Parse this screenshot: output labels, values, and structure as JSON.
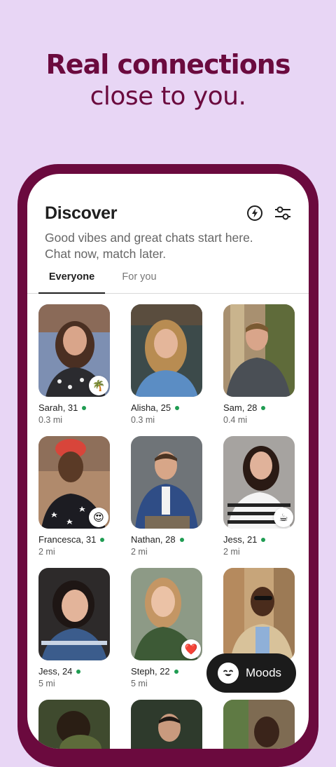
{
  "headline": {
    "line1": "Real connections",
    "line2": "close to you."
  },
  "discover": {
    "title": "Discover",
    "subtitle_line1": "Good vibes and great chats start here.",
    "subtitle_line2": "Chat now, match later.",
    "icons": [
      "lightning-icon",
      "filter-sliders-icon"
    ]
  },
  "tabs": [
    {
      "label": "Everyone",
      "selected": true
    },
    {
      "label": "For you",
      "selected": false
    }
  ],
  "profiles": [
    {
      "name": "Sarah, 31",
      "distance": "0.3 mi",
      "online": true,
      "badge": "🌴"
    },
    {
      "name": "Alisha, 25",
      "distance": "0.3 mi",
      "online": true,
      "badge": ""
    },
    {
      "name": "Sam, 28",
      "distance": "0.4 mi",
      "online": true,
      "badge": ""
    },
    {
      "name": "Francesca, 31",
      "distance": "2 mi",
      "online": true,
      "badge": "😍"
    },
    {
      "name": "Nathan, 28",
      "distance": "2 mi",
      "online": true,
      "badge": ""
    },
    {
      "name": "Jess, 21",
      "distance": "2 mi",
      "online": true,
      "badge": "☕"
    },
    {
      "name": "Jess, 24",
      "distance": "5 mi",
      "online": true,
      "badge": ""
    },
    {
      "name": "Steph, 22",
      "distance": "5 mi",
      "online": true,
      "badge": "❤️"
    },
    {
      "name": "",
      "distance": "",
      "online": false,
      "badge": ""
    }
  ],
  "moods": {
    "label": "Moods",
    "icon": "smiley-face-icon"
  },
  "colors": {
    "background": "#e8d6f5",
    "brand": "#6b0a3e",
    "online": "#1f9c52"
  }
}
